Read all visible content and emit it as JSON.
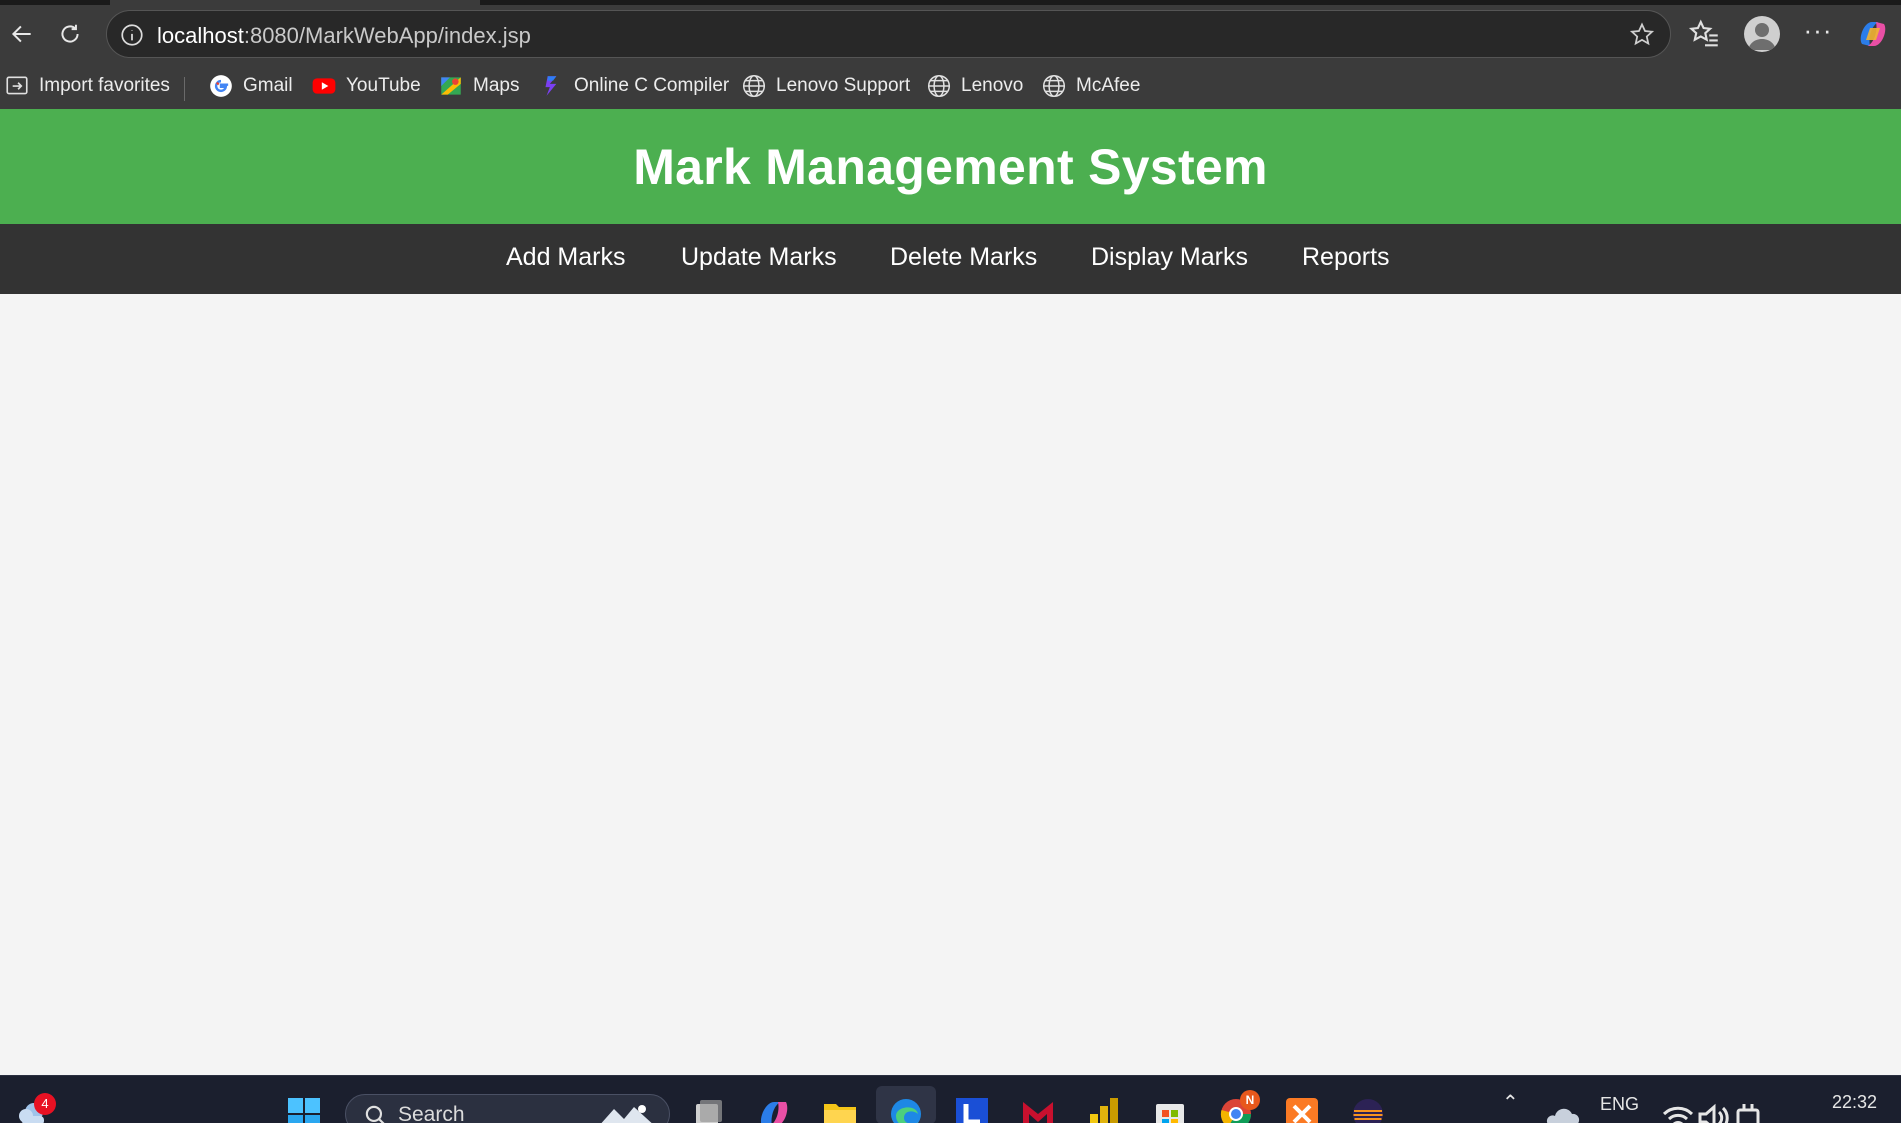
{
  "browser": {
    "url_host": "localhost",
    "url_rest": ":8080/MarkWebApp/index.jsp",
    "bookmarks": [
      {
        "label": "Import favorites",
        "icon": "import-icon"
      },
      {
        "label": "Gmail",
        "icon": "google-icon"
      },
      {
        "label": "YouTube",
        "icon": "youtube-icon"
      },
      {
        "label": "Maps",
        "icon": "maps-icon"
      },
      {
        "label": "Online C Compiler",
        "icon": "compiler-icon"
      },
      {
        "label": "Lenovo Support",
        "icon": "globe-icon"
      },
      {
        "label": "Lenovo",
        "icon": "globe-icon"
      },
      {
        "label": "McAfee",
        "icon": "globe-icon"
      }
    ]
  },
  "app": {
    "title": "Mark Management System",
    "nav": [
      {
        "label": "Add Marks"
      },
      {
        "label": "Update Marks"
      },
      {
        "label": "Delete Marks"
      },
      {
        "label": "Display Marks"
      },
      {
        "label": "Reports"
      }
    ],
    "colors": {
      "header": "#4caf50",
      "nav": "#333333",
      "body": "#f4f4f4"
    }
  },
  "taskbar": {
    "search_label": "Search",
    "weather_badge": "4",
    "notification_badge": "N",
    "language": "ENG",
    "time": "22:32"
  }
}
